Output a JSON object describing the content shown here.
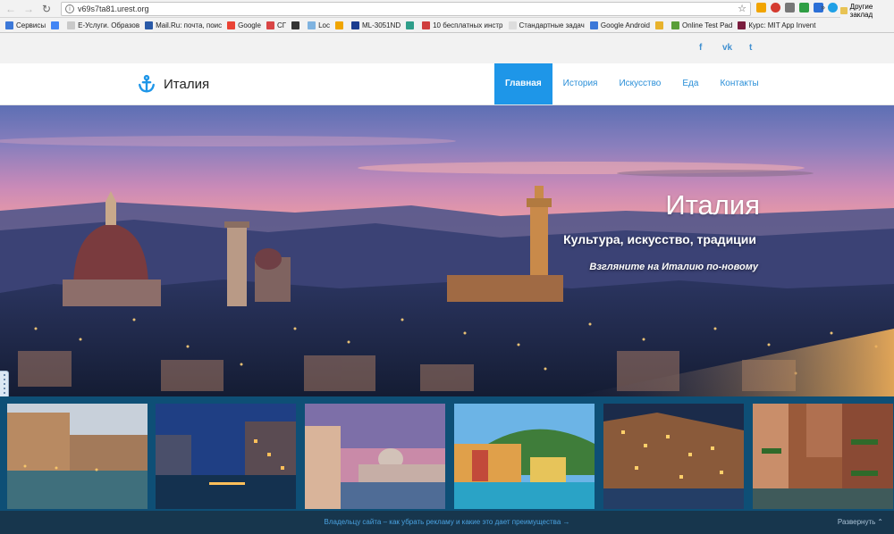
{
  "browser": {
    "url": "v69s7ta81.urest.org",
    "bookmarks": [
      {
        "label": "Сервисы",
        "color": "#3c78d8"
      },
      {
        "label": "",
        "color": "#4285f4"
      },
      {
        "label": "Е-Услуги. Образов",
        "color": "#c9c9c9"
      },
      {
        "label": "Mail.Ru: почта, поис",
        "color": "#2a5aa8"
      },
      {
        "label": "Google",
        "color": "#ea4335"
      },
      {
        "label": "СГ",
        "color": "#d94646"
      },
      {
        "label": "",
        "color": "#333333"
      },
      {
        "label": "Loc",
        "color": "#7fb3e0"
      },
      {
        "label": "",
        "color": "#f0a500"
      },
      {
        "label": "ML-3051ND",
        "color": "#1a3d8f"
      },
      {
        "label": "",
        "color": "#2f9e8a"
      },
      {
        "label": "10 бесплатных инстр",
        "color": "#cf3e3e"
      },
      {
        "label": "Стандартные задач",
        "color": "#dddddd"
      },
      {
        "label": "Google Android",
        "color": "#3c78d8"
      },
      {
        "label": "",
        "color": "#e8b22c"
      },
      {
        "label": "Online Test Pad",
        "color": "#5a9e3a"
      },
      {
        "label": "Курс: MIT App Invent",
        "color": "#7a1d3e"
      }
    ],
    "more_label": "»",
    "other_bookmarks": "Другие заклад"
  },
  "social": {
    "facebook": "f",
    "vk": "vk",
    "twitter": "t"
  },
  "header": {
    "logo_icon": "anchor-icon",
    "site_title": "Италия",
    "menu": [
      {
        "label": "Главная",
        "active": true
      },
      {
        "label": "История",
        "active": false
      },
      {
        "label": "Искусство",
        "active": false
      },
      {
        "label": "Еда",
        "active": false
      },
      {
        "label": "Контакты",
        "active": false
      }
    ]
  },
  "hero": {
    "title": "Италия",
    "subtitle": "Культура, искусство, традиции",
    "tagline": "Взгляните на Италию по-новому"
  },
  "gallery": {
    "items": [
      "venice-canal",
      "venice-night",
      "venice-basilica",
      "coastal-village",
      "cliff-village-night",
      "venice-balconies"
    ]
  },
  "ad_bar": {
    "link": "Владельцу сайта – как убрать рекламу и какие это дает преимущества →",
    "expand": "Развернуть"
  },
  "colors": {
    "accent": "#1e96e8",
    "gallery_bg": "#0e4f76",
    "footer_bg": "#17364d"
  }
}
